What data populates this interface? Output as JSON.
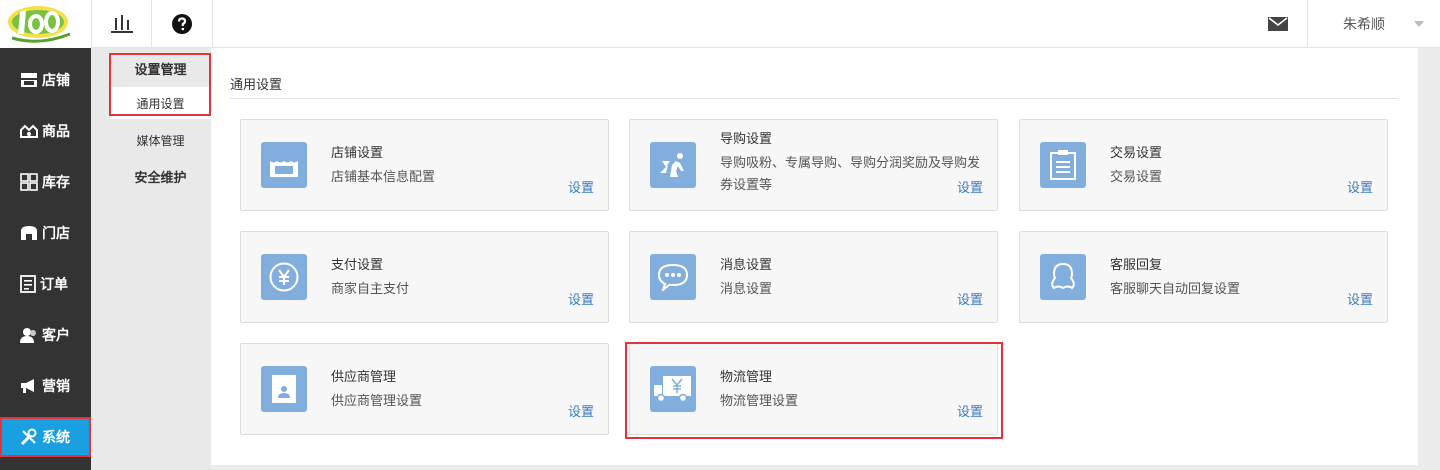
{
  "topbar": {
    "user_name": "朱希顺"
  },
  "sidebar": {
    "items": [
      {
        "label": "店铺",
        "icon": "store-icon"
      },
      {
        "label": "商品",
        "icon": "goods-icon"
      },
      {
        "label": "库存",
        "icon": "grid-icon"
      },
      {
        "label": "门店",
        "icon": "shop-icon"
      },
      {
        "label": "订单",
        "icon": "order-icon"
      },
      {
        "label": "客户",
        "icon": "user-icon"
      },
      {
        "label": "营销",
        "icon": "megaphone-icon"
      },
      {
        "label": "系统",
        "icon": "tools-icon",
        "active": true
      }
    ]
  },
  "subnav": {
    "group1": "设置管理",
    "item_general": "通用设置",
    "item_media": "媒体管理",
    "group2": "安全维护"
  },
  "main": {
    "section_title": "通用设置",
    "cards": [
      {
        "title": "店铺设置",
        "desc": "店铺基本信息配置",
        "link": "设置",
        "icon": "storefront-icon"
      },
      {
        "title": "导购设置",
        "desc": "导购吸粉、专属导购、导购分润奖励及导购发券设置等",
        "link": "设置",
        "icon": "guide-icon"
      },
      {
        "title": "交易设置",
        "desc": "交易设置",
        "link": "设置",
        "icon": "clipboard-icon"
      },
      {
        "title": "支付设置",
        "desc": "商家自主支付",
        "link": "设置",
        "icon": "yuan-coin-icon"
      },
      {
        "title": "消息设置",
        "desc": "消息设置",
        "link": "设置",
        "icon": "chat-bubble-icon"
      },
      {
        "title": "客服回复",
        "desc": "客服聊天自动回复设置",
        "link": "设置",
        "icon": "customer-service-icon"
      },
      {
        "title": "供应商管理",
        "desc": "供应商管理设置",
        "link": "设置",
        "icon": "supplier-badge-icon"
      },
      {
        "title": "物流管理",
        "desc": "物流管理设置",
        "link": "设置",
        "icon": "delivery-truck-icon"
      }
    ]
  },
  "colors": {
    "accent": "#1aa0e0",
    "highlight": "#e1343d",
    "icon_bg": "#82aedd",
    "link": "#3c7bc0",
    "sidebar_bg": "#333333"
  }
}
